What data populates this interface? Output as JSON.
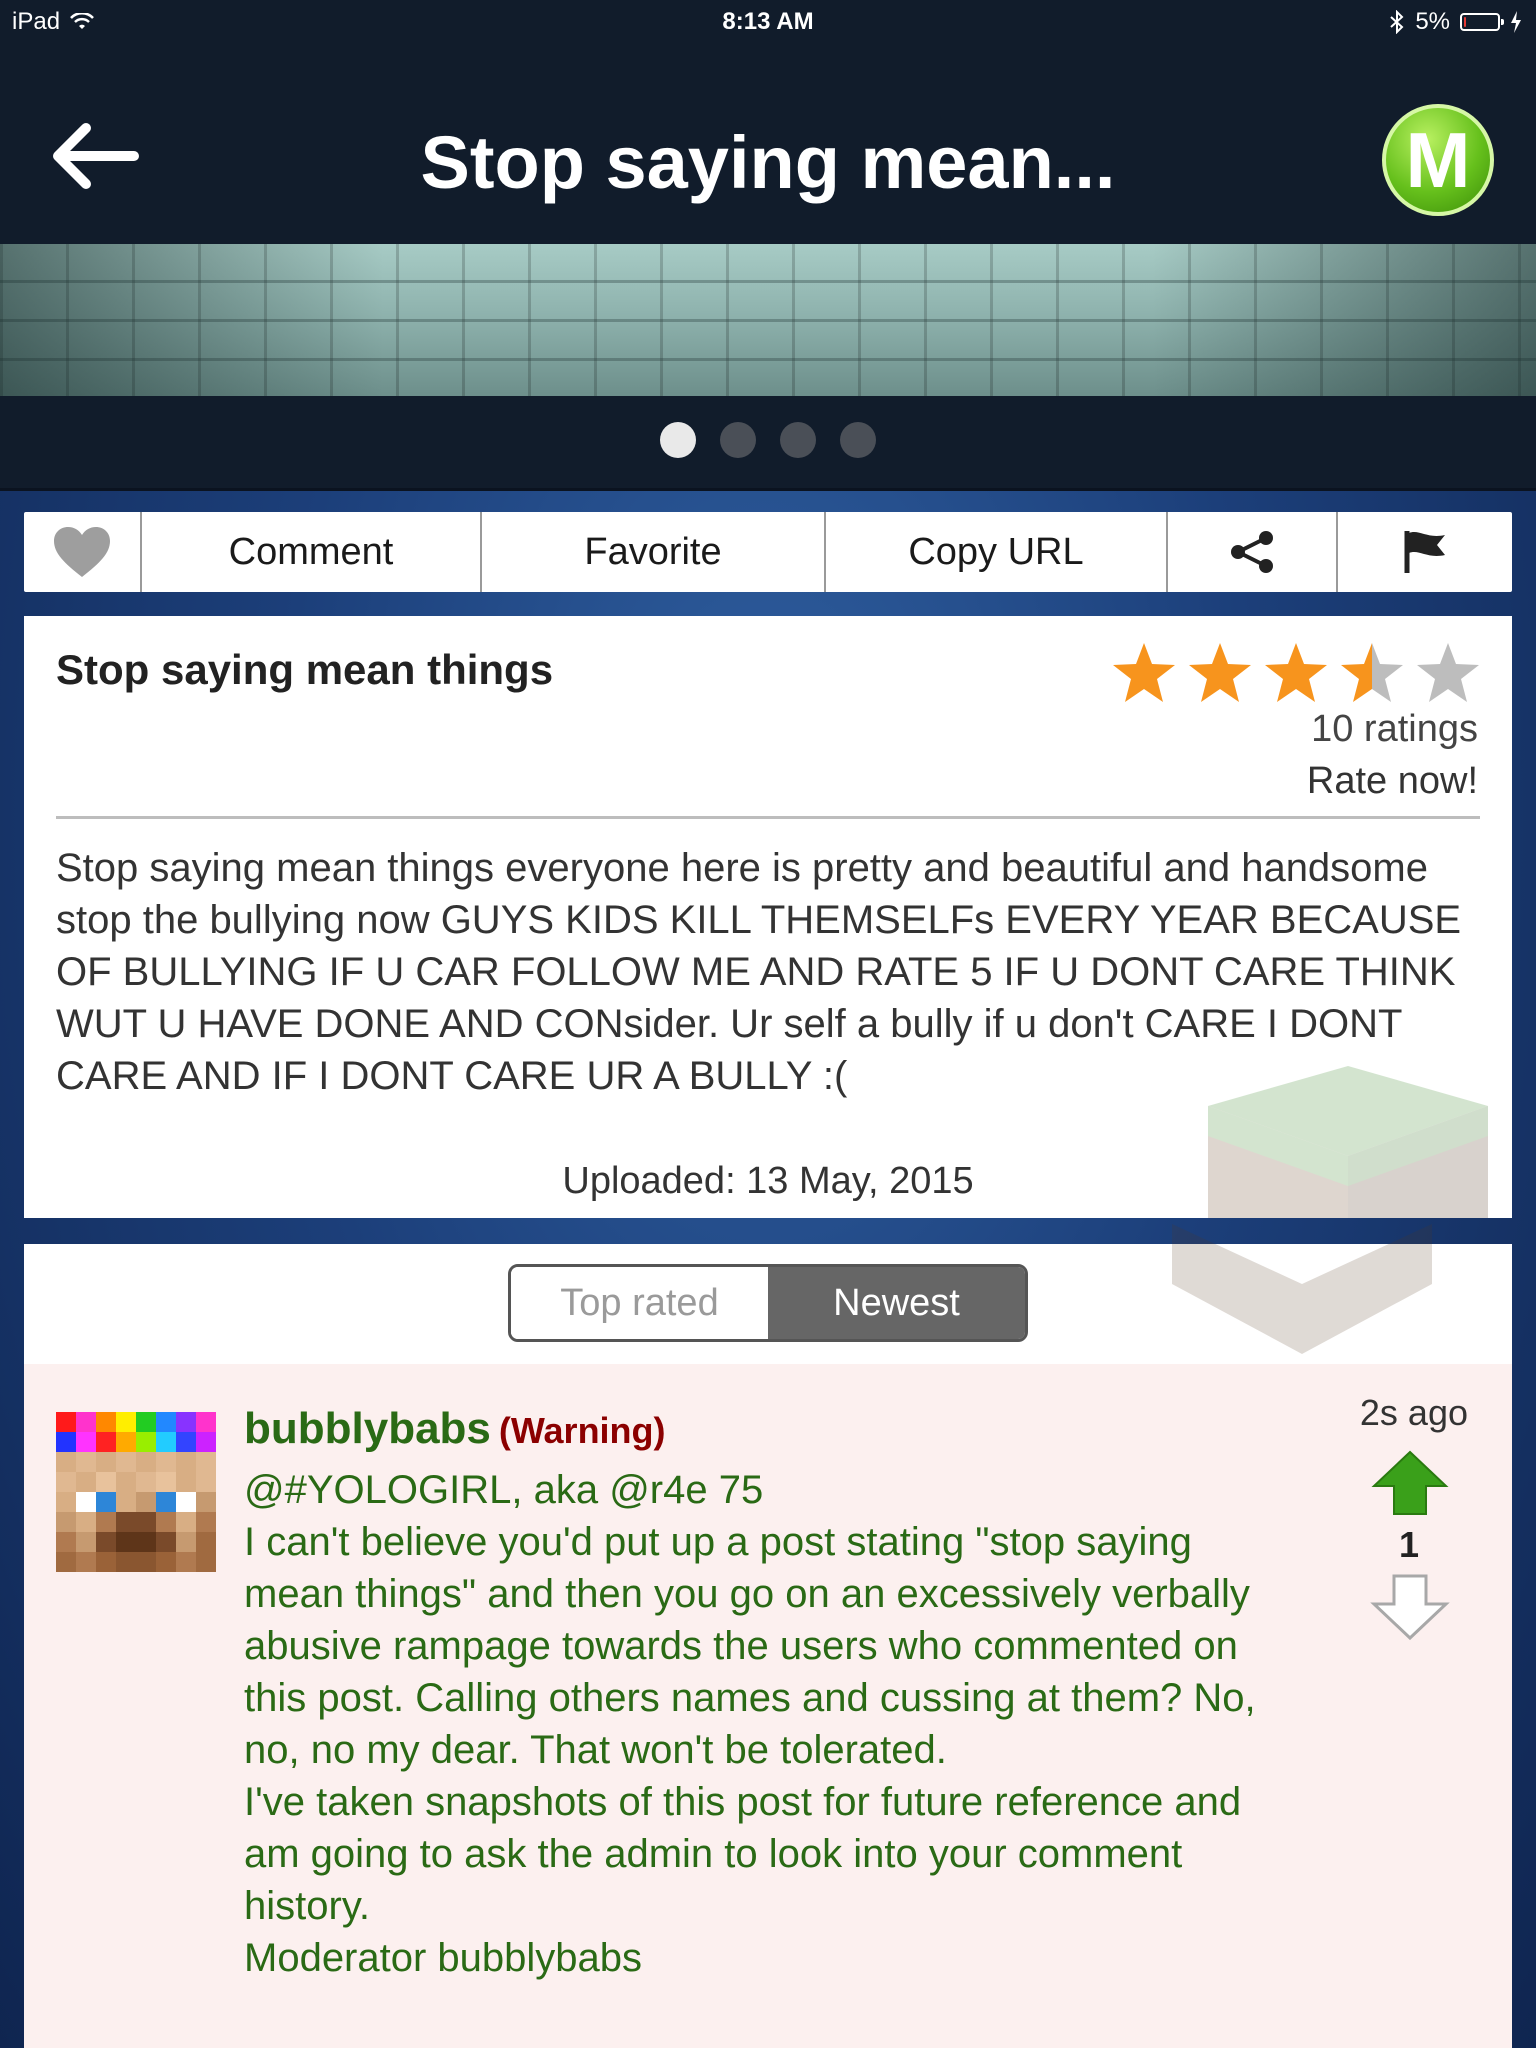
{
  "status_bar": {
    "device": "iPad",
    "time": "8:13 AM",
    "battery": "5%",
    "battery_level": 0.05
  },
  "nav": {
    "title": "Stop saying mean...",
    "logo_letter": "M"
  },
  "carousel": {
    "dot_count": 4,
    "active_index": 0
  },
  "actions": {
    "comment": "Comment",
    "favorite": "Favorite",
    "copy_url": "Copy URL"
  },
  "post": {
    "title": "Stop saying mean things",
    "rating": 3.5,
    "ratings_count": "10 ratings",
    "rate_now": "Rate now!",
    "body": "Stop saying mean things everyone here is pretty and beautiful and handsome stop the bullying now GUYS KIDS KILL THEMSELFs EVERY YEAR BECAUSE OF BULLYING IF U CAR FOLLOW ME AND RATE 5 IF U DONT CARE THINK WUT U HAVE DONE AND CONsider. Ur self a bully if u don't CARE I DONT CARE AND IF I DONT CARE UR A BULLY :(",
    "uploaded": "Uploaded: 13 May, 2015"
  },
  "sort": {
    "top_rated": "Top rated",
    "newest": "Newest",
    "selected": "Newest"
  },
  "comment": {
    "username": "bubblybabs",
    "warning": "(Warning)",
    "time": "2s ago",
    "votes": "1",
    "mention": "@#YOLOGIRL, aka @r4e 75",
    "paragraph1": "I can't believe you'd put up a post stating \"stop saying mean things\" and then you go on an excessively verbally abusive rampage towards the users who commented on this post. Calling others names and cussing at them? No, no, no my dear. That won't be tolerated.",
    "paragraph2": "I've taken snapshots of this post for future reference and am going to ask the admin to look into your comment history.",
    "signature": "Moderator bubblybabs"
  },
  "colors": {
    "star_filled": "#f7941d",
    "star_empty": "#bdbdbd",
    "username": "#2a6a15",
    "warning": "#8b0000",
    "upvote": "#3aa01a",
    "nav_background": "#111c2b"
  }
}
